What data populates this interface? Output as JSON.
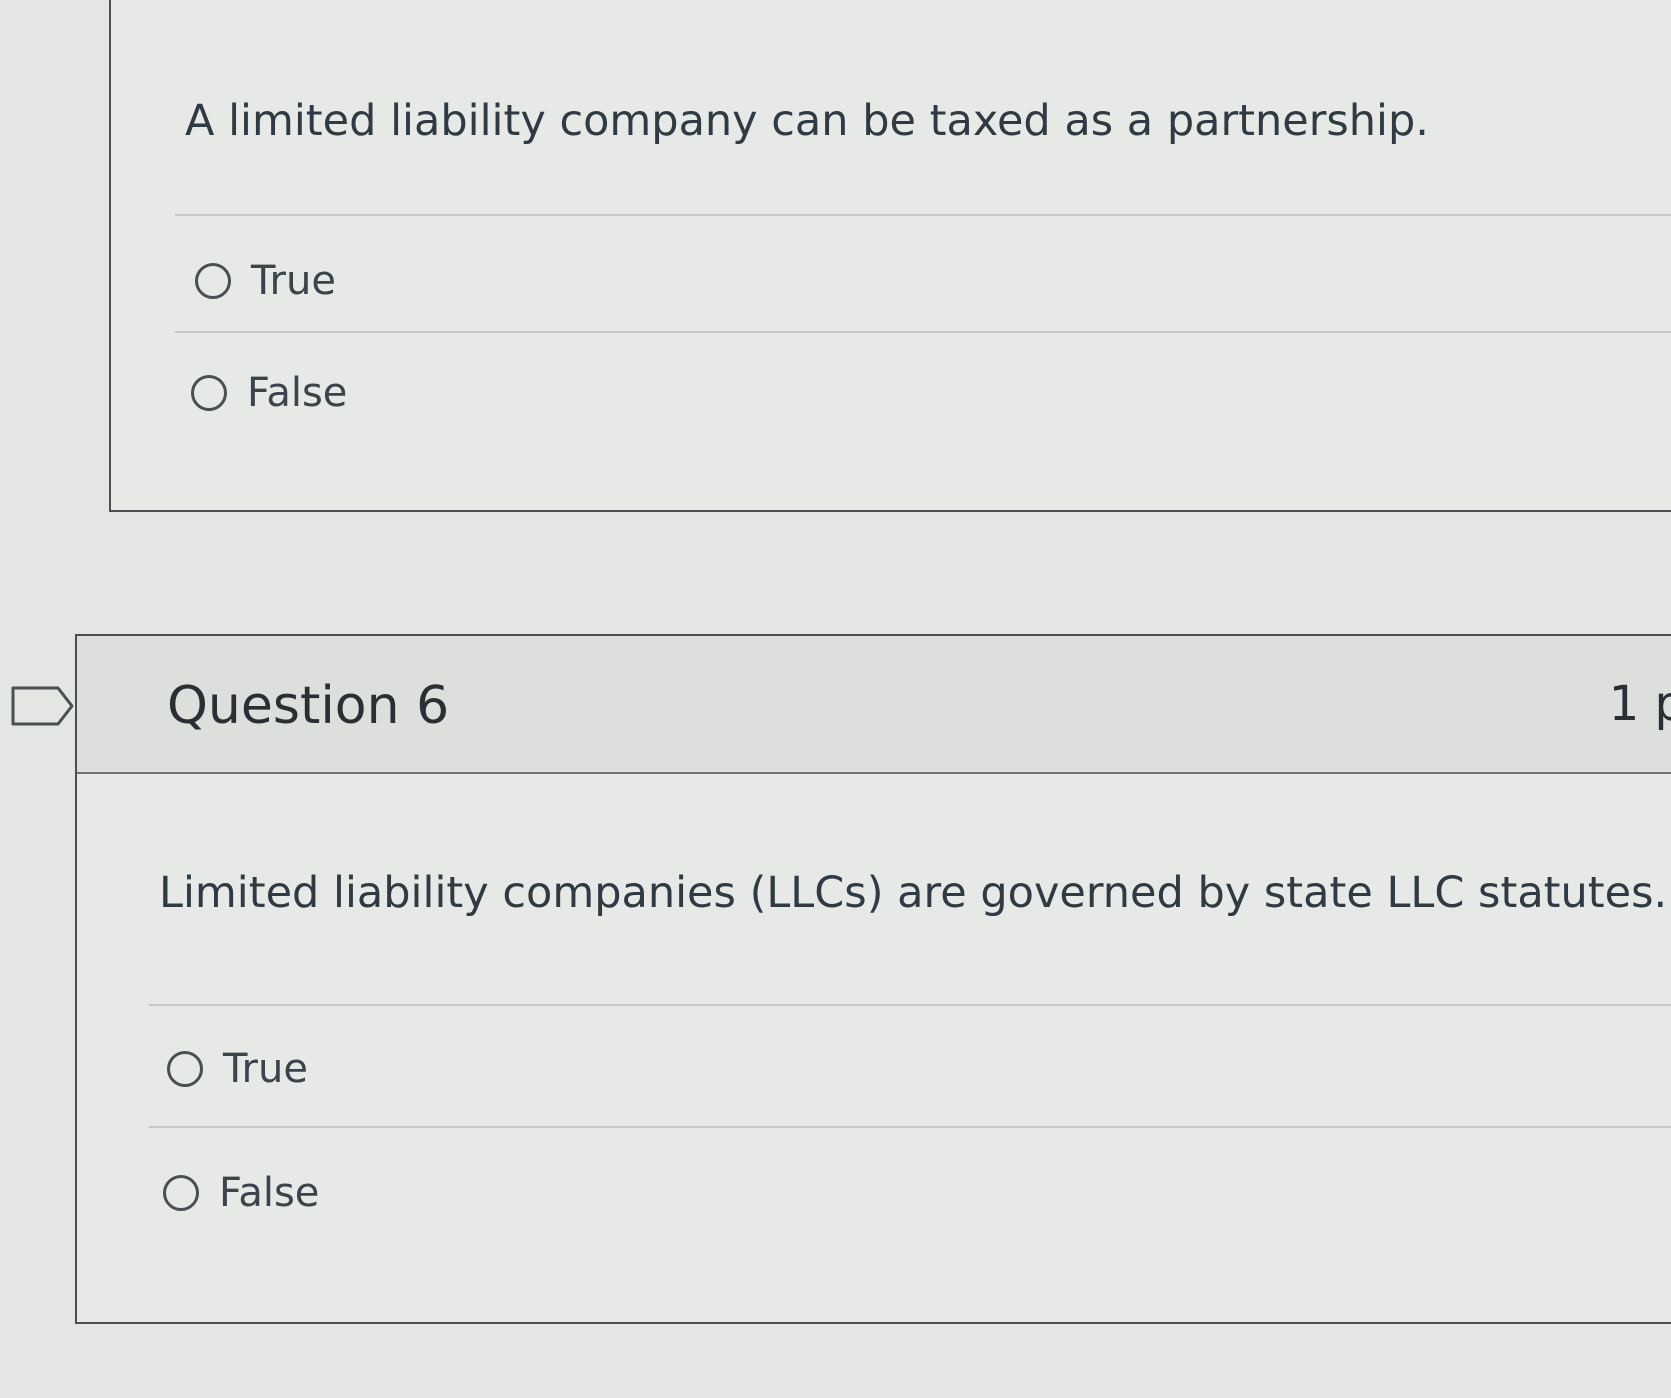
{
  "question_5": {
    "text": "A limited liability company can be taxed as a partnership.",
    "answers": [
      {
        "label": "True",
        "selected": false
      },
      {
        "label": "False",
        "selected": false
      }
    ]
  },
  "question_6": {
    "title": "Question 6",
    "points": "1 p",
    "text": "Limited liability companies (LLCs) are governed by state LLC statutes.",
    "answers": [
      {
        "label": "True",
        "selected": false
      },
      {
        "label": "False",
        "selected": false
      }
    ]
  },
  "icons": {
    "flag": "flag-question-icon",
    "radio": "radio-button-icon"
  },
  "colors": {
    "background": "#e4e6e3",
    "card_border": "#4a4f52",
    "text": "#2f3a42"
  }
}
